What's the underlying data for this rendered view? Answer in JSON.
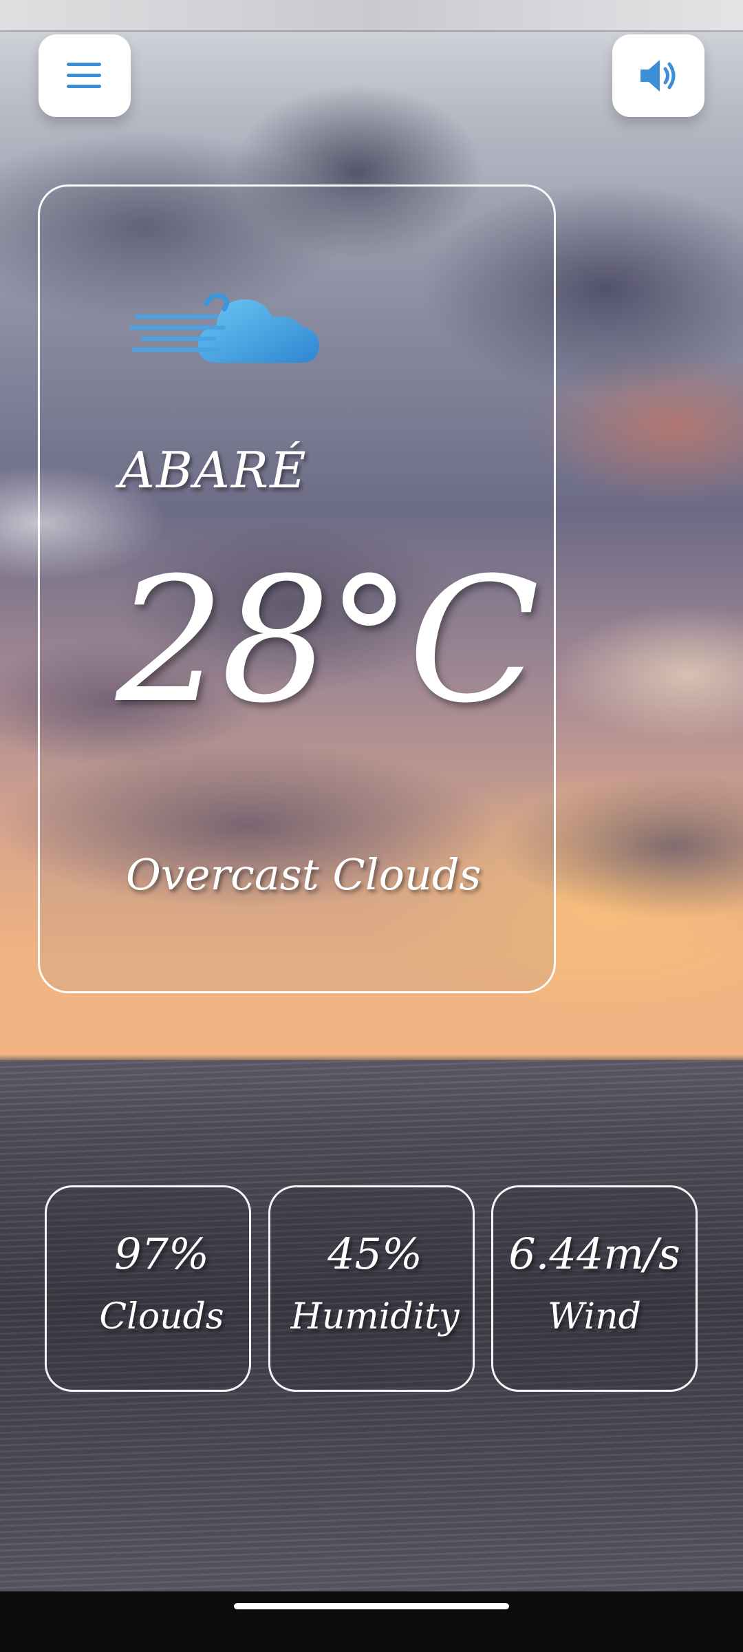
{
  "weather": {
    "city": "ABARÉ",
    "temperature": "28°C",
    "condition": "Overcast Clouds",
    "icon": "wind-cloud-icon"
  },
  "stats": [
    {
      "value": "97%",
      "label": "Clouds"
    },
    {
      "value": "45%",
      "label": "Humidity"
    },
    {
      "value": "6.44m/s",
      "label": "Wind"
    }
  ],
  "controls": {
    "menu_icon": "hamburger-menu-icon",
    "sound_icon": "speaker-icon"
  },
  "colors": {
    "accent": "#3b8fd6",
    "card_border": "#ffffff",
    "button_bg": "#ffffff"
  }
}
